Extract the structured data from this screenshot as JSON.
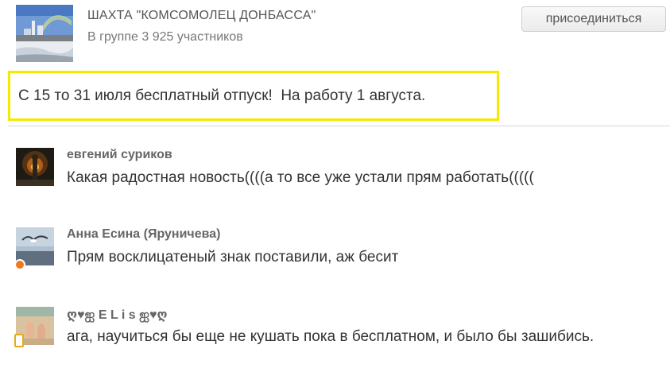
{
  "group": {
    "name": "ШАХТА \"КОМСОМОЛЕЦ ДОНБАССА\"",
    "members": "В группе 3 925 участников",
    "join_label": "присоединиться"
  },
  "post": {
    "text": "С 15 то 31 июля бесплатный отпуск!  На работу 1 августа.",
    "highlight_color": "#f3ea00"
  },
  "comments": [
    {
      "author": "евгений суриков",
      "text": "Какая радостная новость((((а то все уже устали прям работать(((((",
      "avatar": "fire-figure-avatar"
    },
    {
      "author": "Анна Есина (Яруничева)",
      "text": "Прям восклицатеный знак поставили, аж бесит",
      "avatar": "seagull-avatar",
      "status": "online-dot"
    },
    {
      "author": "ღ♥ஐ E L i s ஐ♥ღ",
      "text": "ага, научиться бы еще не кушать пока в бесплатном, и было бы зашибись.",
      "avatar": "beach-feet-avatar",
      "status": "mobile-badge"
    }
  ],
  "colors": {
    "status_orange": "#f07a1a",
    "mobile_yellow": "#e8a91b",
    "divider": "#d8d8d8"
  }
}
